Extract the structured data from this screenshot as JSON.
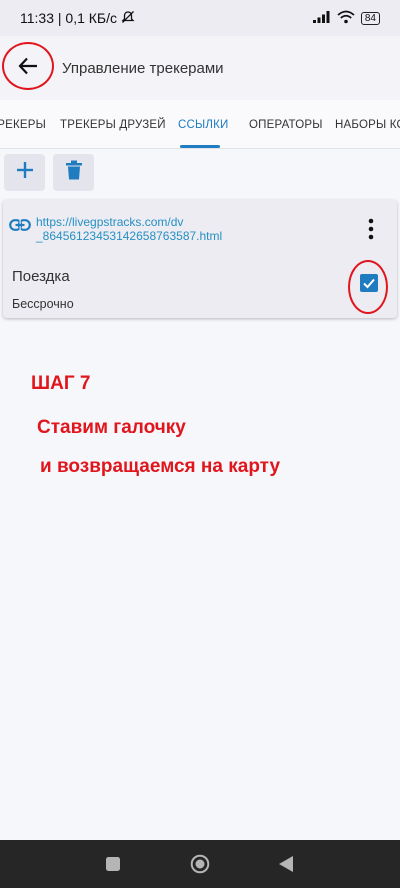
{
  "status_bar": {
    "time_speed": "11:33 | 0,1 КБ/с",
    "battery": "84"
  },
  "app_bar": {
    "title": "Управление трекерами"
  },
  "tabs": [
    {
      "label": "ТРЕКЕРЫ",
      "active": false
    },
    {
      "label": "ТРЕКЕРЫ ДРУЗЕЙ",
      "active": false
    },
    {
      "label": "ССЫЛКИ",
      "active": true
    },
    {
      "label": "ОПЕРАТОРЫ",
      "active": false
    },
    {
      "label": "НАБОРЫ КОМ",
      "active": false
    }
  ],
  "card": {
    "link": "https://livegpstracks.com/dv_864561234531426587635​87.html",
    "link_line1": "https://livegpstracks.com/dv",
    "link_line2": "_86456123453142658763587.html",
    "name": "Поездка",
    "duration": "Бессрочно",
    "checked": true
  },
  "annotations": {
    "step": "ШАГ 7",
    "line1": "Ставим галочку",
    "line2": "и возвращаемся на карту"
  },
  "colors": {
    "accent": "#1f7cc0",
    "annotation_red": "#e0161c",
    "link": "#2690c4"
  }
}
